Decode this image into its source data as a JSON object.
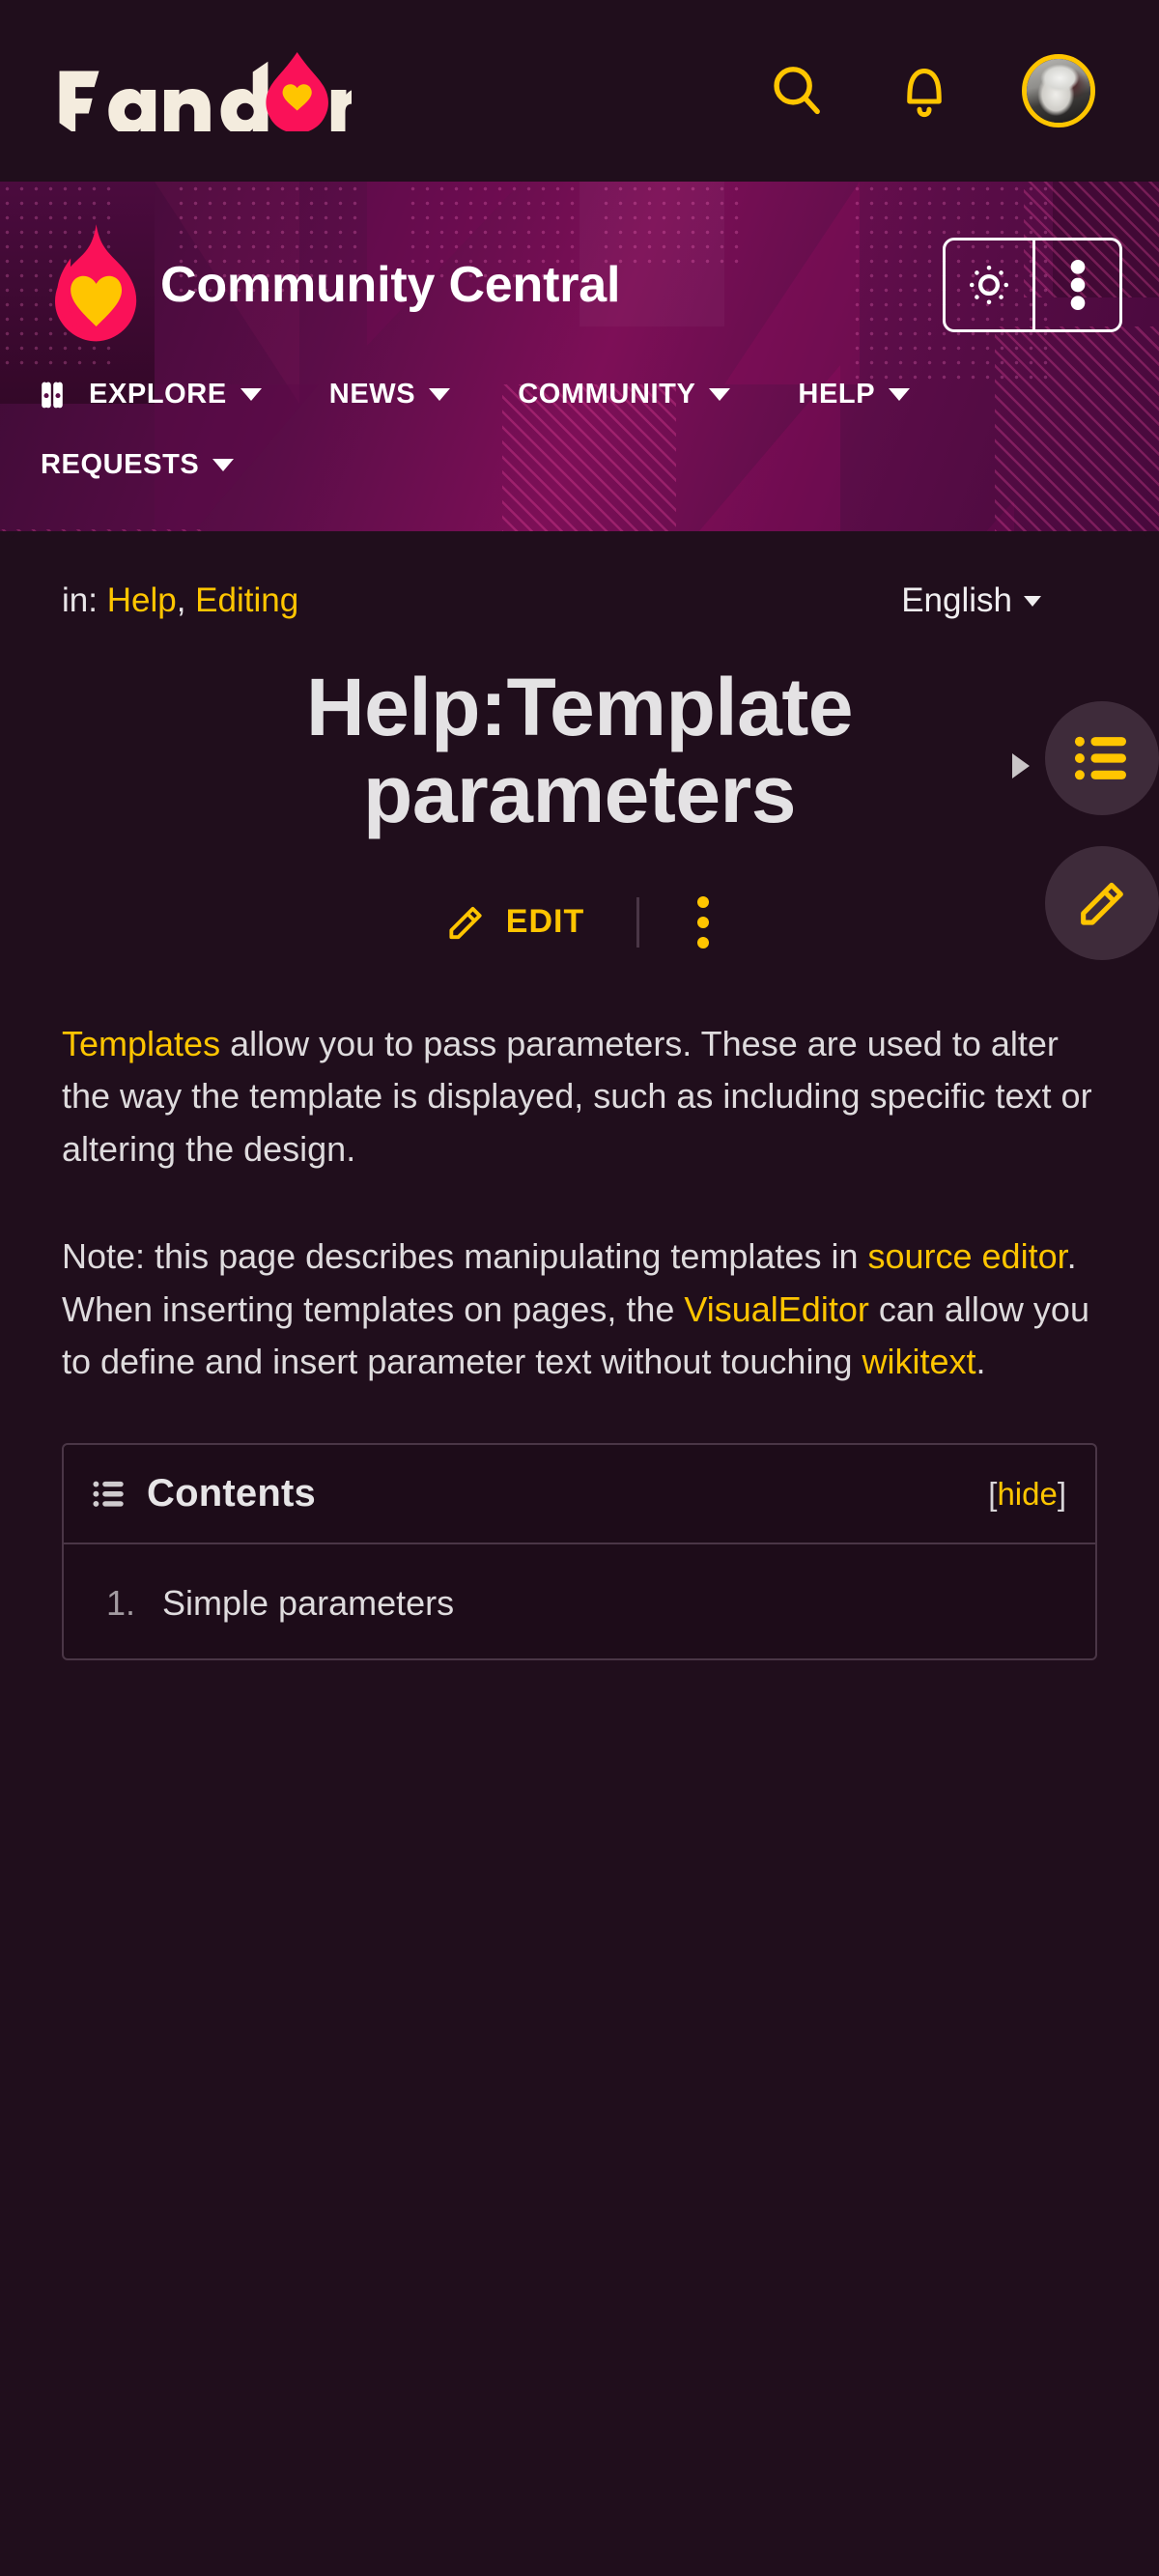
{
  "global_nav": {
    "brand": "Fandom",
    "icons": [
      {
        "name": "search-icon",
        "label": "Search"
      },
      {
        "name": "notifications-bell-icon",
        "label": "Notifications"
      },
      {
        "name": "user-avatar",
        "label": "User avatar"
      }
    ]
  },
  "wiki_header": {
    "title": "Community Central",
    "logo_name": "fandom-flame-logo",
    "theme_toggle_label": "Light theme",
    "overflow_label": "More options"
  },
  "wiki_nav": {
    "items": [
      {
        "label": "EXPLORE",
        "icon": "open-book-icon",
        "has_dropdown": true
      },
      {
        "label": "NEWS",
        "icon": null,
        "has_dropdown": true
      },
      {
        "label": "COMMUNITY",
        "icon": null,
        "has_dropdown": true
      },
      {
        "label": "HELP",
        "icon": null,
        "has_dropdown": true
      },
      {
        "label": "REQUESTS",
        "icon": null,
        "has_dropdown": true
      }
    ]
  },
  "page": {
    "breadcrumb_prefix": "in:",
    "categories": [
      "Help",
      "Editing"
    ],
    "category_separator": ", ",
    "language": "English",
    "title": "Help:Template parameters",
    "edit_label": "EDIT",
    "overflow_label": "More"
  },
  "article": {
    "paragraph_1": {
      "link_templates": "Templates",
      "rest": " allow you to pass parameters. These are used to alter the way the template is displayed, such as including specific text or altering the design."
    },
    "paragraph_2": {
      "part_1": "Note: this page describes manipulating templates in ",
      "link_source_editor": "source editor",
      "part_2": ". When inserting templates on pages, the ",
      "link_visualeditor": "VisualEditor",
      "part_3": " can allow you to define and insert parameter text without touching ",
      "link_wikitext": "wikitext",
      "part_4": "."
    }
  },
  "toc": {
    "title": "Contents",
    "icon": "bulleted-list-icon",
    "toggle_open_bracket": "[",
    "toggle_label": "hide",
    "toggle_close_bracket": "]",
    "items": [
      {
        "number": "1.",
        "label": "Simple parameters"
      }
    ]
  },
  "floating_actions": [
    {
      "name": "toc-fab",
      "icon": "bulleted-list-icon",
      "label": "Contents"
    },
    {
      "name": "edit-fab",
      "icon": "pencil-icon",
      "label": "Edit"
    }
  ],
  "colors": {
    "accent_yellow": "#ffc500",
    "page_background": "#200e1c",
    "header_purple": "#5b0d48",
    "header_magenta": "#7d0f57",
    "flame_pink": "#ff1f4b",
    "flame_heart_yellow": "#ffc500",
    "text_primary": "#dedbdd",
    "logo_cream": "#f4ecde"
  }
}
